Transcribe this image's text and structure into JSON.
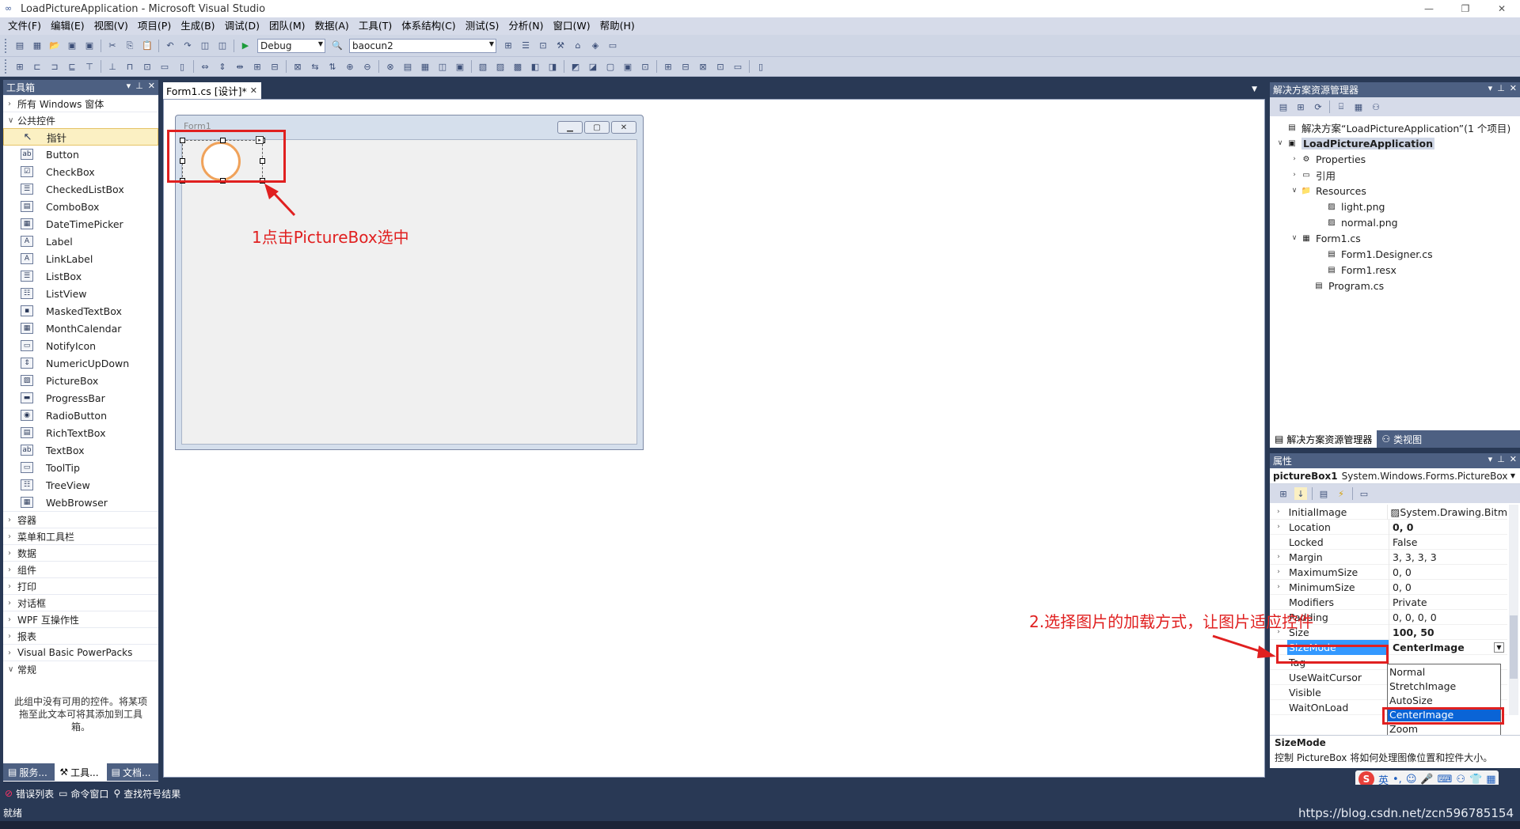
{
  "window": {
    "title": "LoadPictureApplication - Microsoft Visual Studio"
  },
  "menu": [
    "文件(F)",
    "编辑(E)",
    "视图(V)",
    "项目(P)",
    "生成(B)",
    "调试(D)",
    "团队(M)",
    "数据(A)",
    "工具(T)",
    "体系结构(C)",
    "测试(S)",
    "分析(N)",
    "窗口(W)",
    "帮助(H)"
  ],
  "toolbar": {
    "config": "Debug",
    "search": "baocun2"
  },
  "toolbox": {
    "title": "工具箱",
    "sections_top": [
      "所有 Windows 窗体",
      "公共控件"
    ],
    "items": [
      "指针",
      "Button",
      "CheckBox",
      "CheckedListBox",
      "ComboBox",
      "DateTimePicker",
      "Label",
      "LinkLabel",
      "ListBox",
      "ListView",
      "MaskedTextBox",
      "MonthCalendar",
      "NotifyIcon",
      "NumericUpDown",
      "PictureBox",
      "ProgressBar",
      "RadioButton",
      "RichTextBox",
      "TextBox",
      "ToolTip",
      "TreeView",
      "WebBrowser"
    ],
    "sections_bottom": [
      "容器",
      "菜单和工具栏",
      "数据",
      "组件",
      "打印",
      "对话框",
      "WPF 互操作性",
      "报表",
      "Visual Basic PowerPacks",
      "常规"
    ],
    "note": "此组中没有可用的控件。将某项拖至此文本可将其添加到工具箱。",
    "tabs": [
      "服务...",
      "工具...",
      "文档..."
    ]
  },
  "document": {
    "tab": "Form1.cs [设计]*",
    "form_title": "Form1"
  },
  "annotations": {
    "step1": "1点击PictureBox选中",
    "step2": "2.选择图片的加载方式，让图片适应控件"
  },
  "solution_explorer": {
    "title": "解决方案资源管理器",
    "solution": "解决方案“LoadPictureApplication”(1 个项目)",
    "project": "LoadPictureApplication",
    "nodes": [
      "Properties",
      "引用",
      "Resources",
      "light.png",
      "normal.png",
      "Form1.cs",
      "Form1.Designer.cs",
      "Form1.resx",
      "Program.cs"
    ],
    "tabs": [
      "解决方案资源管理器",
      "类视图"
    ]
  },
  "properties": {
    "title": "属性",
    "object_name": "pictureBox1",
    "object_type": "System.Windows.Forms.PictureBox",
    "rows": [
      {
        "name": "InitialImage",
        "value": "System.Drawing.Bitm",
        "expand": true
      },
      {
        "name": "Location",
        "value": "0, 0",
        "expand": true,
        "bold": true
      },
      {
        "name": "Locked",
        "value": "False"
      },
      {
        "name": "Margin",
        "value": "3, 3, 3, 3",
        "expand": true
      },
      {
        "name": "MaximumSize",
        "value": "0, 0",
        "expand": true
      },
      {
        "name": "MinimumSize",
        "value": "0, 0",
        "expand": true
      },
      {
        "name": "Modifiers",
        "value": "Private"
      },
      {
        "name": "Padding",
        "value": "0, 0, 0, 0",
        "expand": true
      },
      {
        "name": "Size",
        "value": "100, 50",
        "expand": true,
        "bold": true
      },
      {
        "name": "SizeMode",
        "value": "CenterImage",
        "bold": true,
        "selected": true
      },
      {
        "name": "Tag",
        "value": ""
      },
      {
        "name": "UseWaitCursor",
        "value": ""
      },
      {
        "name": "Visible",
        "value": ""
      },
      {
        "name": "WaitOnLoad",
        "value": ""
      }
    ],
    "dropdown_options": [
      "Normal",
      "StretchImage",
      "AutoSize",
      "CenterImage",
      "Zoom"
    ],
    "dropdown_selected": "CenterImage",
    "desc_title": "SizeMode",
    "desc_text": "控制 PictureBox 将如何处理图像位置和控件大小。"
  },
  "bottom_tabs": [
    "错误列表",
    "命令窗口",
    "查找符号结果"
  ],
  "status": "就绪",
  "ime": {
    "logo": "S",
    "lang": "英"
  },
  "watermark": "https://blog.csdn.net/zcn596785154",
  "colors": {
    "accent": "#293955",
    "annotation": "#e02020",
    "selection": "#3399ff"
  }
}
